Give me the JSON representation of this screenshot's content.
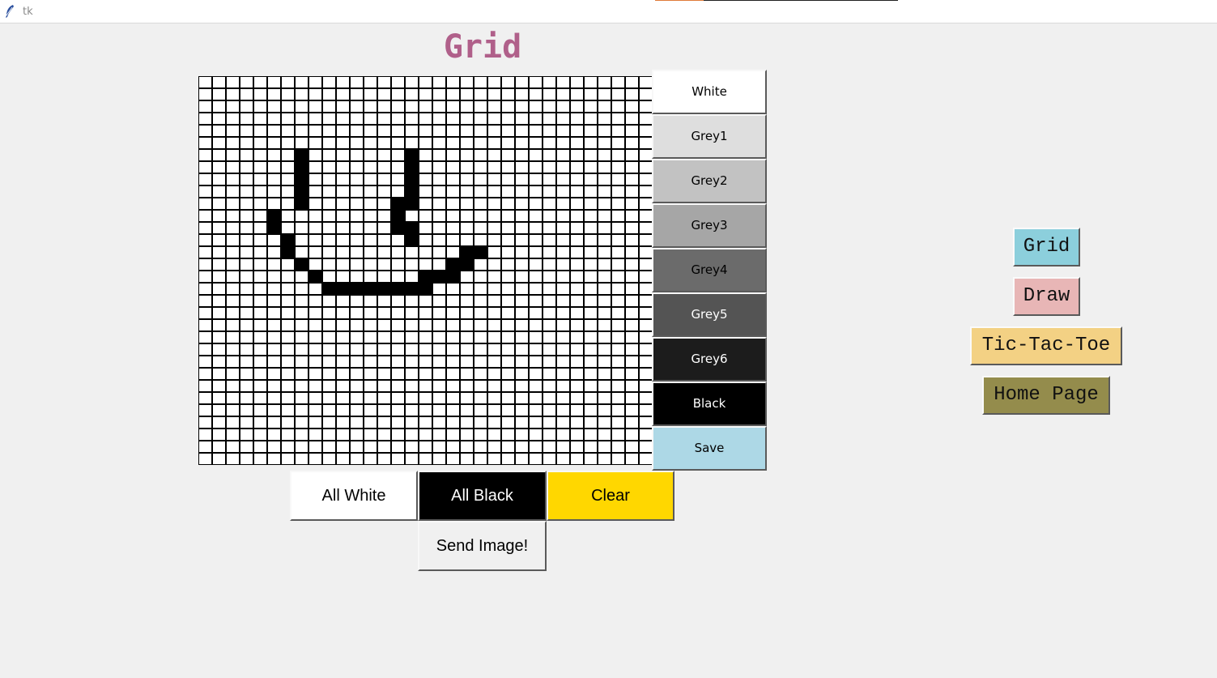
{
  "window": {
    "title": "tk"
  },
  "page": {
    "title": "Grid"
  },
  "grid": {
    "cols": 33,
    "rows": 32,
    "filled": [
      [
        6,
        7
      ],
      [
        6,
        15
      ],
      [
        7,
        7
      ],
      [
        7,
        15
      ],
      [
        8,
        7
      ],
      [
        8,
        15
      ],
      [
        9,
        7
      ],
      [
        9,
        15
      ],
      [
        10,
        7
      ],
      [
        10,
        14
      ],
      [
        10,
        15
      ],
      [
        11,
        5
      ],
      [
        11,
        14
      ],
      [
        12,
        5
      ],
      [
        12,
        14
      ],
      [
        12,
        15
      ],
      [
        13,
        6
      ],
      [
        13,
        15
      ],
      [
        14,
        6
      ],
      [
        14,
        19
      ],
      [
        14,
        20
      ],
      [
        15,
        7
      ],
      [
        15,
        18
      ],
      [
        15,
        19
      ],
      [
        16,
        8
      ],
      [
        16,
        16
      ],
      [
        16,
        17
      ],
      [
        16,
        18
      ],
      [
        17,
        9
      ],
      [
        17,
        10
      ],
      [
        17,
        11
      ],
      [
        17,
        12
      ],
      [
        17,
        13
      ],
      [
        17,
        14
      ],
      [
        17,
        15
      ],
      [
        17,
        16
      ]
    ]
  },
  "palette": [
    {
      "label": "White",
      "bg": "#ffffff",
      "fg": "#000000"
    },
    {
      "label": "Grey1",
      "bg": "#dedede",
      "fg": "#000000"
    },
    {
      "label": "Grey2",
      "bg": "#c2c2c2",
      "fg": "#000000"
    },
    {
      "label": "Grey3",
      "bg": "#a6a6a6",
      "fg": "#000000"
    },
    {
      "label": "Grey4",
      "bg": "#6b6b6b",
      "fg": "#000000"
    },
    {
      "label": "Grey5",
      "bg": "#545454",
      "fg": "#ffffff"
    },
    {
      "label": "Grey6",
      "bg": "#1c1c1c",
      "fg": "#ffffff"
    },
    {
      "label": "Black",
      "bg": "#000000",
      "fg": "#ffffff"
    },
    {
      "label": "Save",
      "bg": "#add8e6",
      "fg": "#000000"
    }
  ],
  "actions": {
    "all_white": "All White",
    "all_black": "All Black",
    "clear": "Clear",
    "send": "Send Image!"
  },
  "nav": {
    "grid": "Grid",
    "draw": "Draw",
    "tictactoe": "Tic-Tac-Toe",
    "home": "Home Page"
  },
  "colors": {
    "title": "#b0608a",
    "nav_grid": "#8ccfdc",
    "nav_draw": "#e8b6b6",
    "nav_tictactoe": "#f3d184",
    "nav_home": "#948c4c",
    "clear": "#ffd700"
  }
}
